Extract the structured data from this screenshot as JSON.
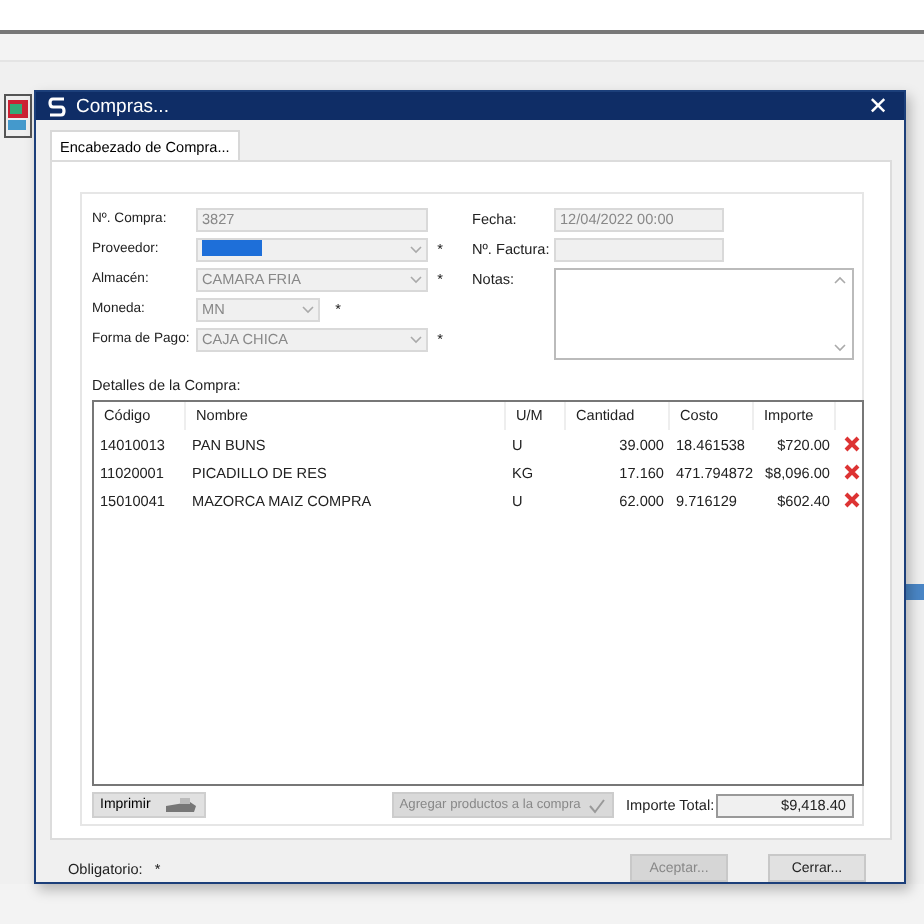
{
  "window": {
    "title": "Compras...",
    "close": "✕"
  },
  "tabs": [
    {
      "label": "Encabezado de Compra...",
      "selected": true
    }
  ],
  "form": {
    "left": [
      {
        "label": "Nº. Compra:",
        "kind": "text",
        "value": "3827",
        "disabled": true
      },
      {
        "label": "Proveedor:",
        "kind": "combo",
        "selection": true,
        "disabled": true,
        "required": true
      },
      {
        "label": "Almacén:",
        "kind": "combo",
        "value": "CAMARA FRIA",
        "disabled": true,
        "required": true
      },
      {
        "label": "Moneda:",
        "kind": "short-combo",
        "value": "MN",
        "disabled": true,
        "required": true
      },
      {
        "label": "Forma de Pago:",
        "kind": "combo",
        "value": "CAJA CHICA",
        "disabled": true,
        "required": true
      }
    ],
    "right": [
      {
        "label": "Fecha:",
        "kind": "text",
        "value": "12/04/2022 00:00",
        "disabled": true
      },
      {
        "label": "Nº. Factura:",
        "kind": "text",
        "disabled": true
      },
      {
        "label": "Notas:",
        "kind": "memo",
        "disabled": false
      }
    ],
    "required_mark": "*"
  },
  "details": {
    "title": "Detalles de la Compra:",
    "columns": [
      "Código",
      "Nombre",
      "U/M",
      "Cantidad",
      "Costo",
      "Importe"
    ],
    "rows": [
      {
        "cells": [
          "14010013",
          "PAN BUNS",
          "U",
          "39.000",
          "18.461538",
          "$720.00"
        ]
      },
      {
        "cells": [
          "11020001",
          "PICADILLO DE RES",
          "KG",
          "17.160",
          "471.794872",
          "$8,096.00"
        ]
      },
      {
        "cells": [
          "15010041",
          "MAZORCA MAIZ COMPRA",
          "U",
          "62.000",
          "9.716129",
          "$602.40"
        ]
      }
    ]
  },
  "print_button": {
    "label": "Imprimir"
  },
  "add_button": {
    "label": "Agregar productos a la compra",
    "disabled": true
  },
  "total": {
    "label": "Importe Total:",
    "value": "$9,418.40"
  },
  "footer": {
    "legend": "Obligatorio:",
    "mark": "*"
  },
  "buttons": [
    {
      "label": "Aceptar...",
      "disabled": true
    },
    {
      "label": "Cerrar...",
      "disabled": false
    }
  ]
}
